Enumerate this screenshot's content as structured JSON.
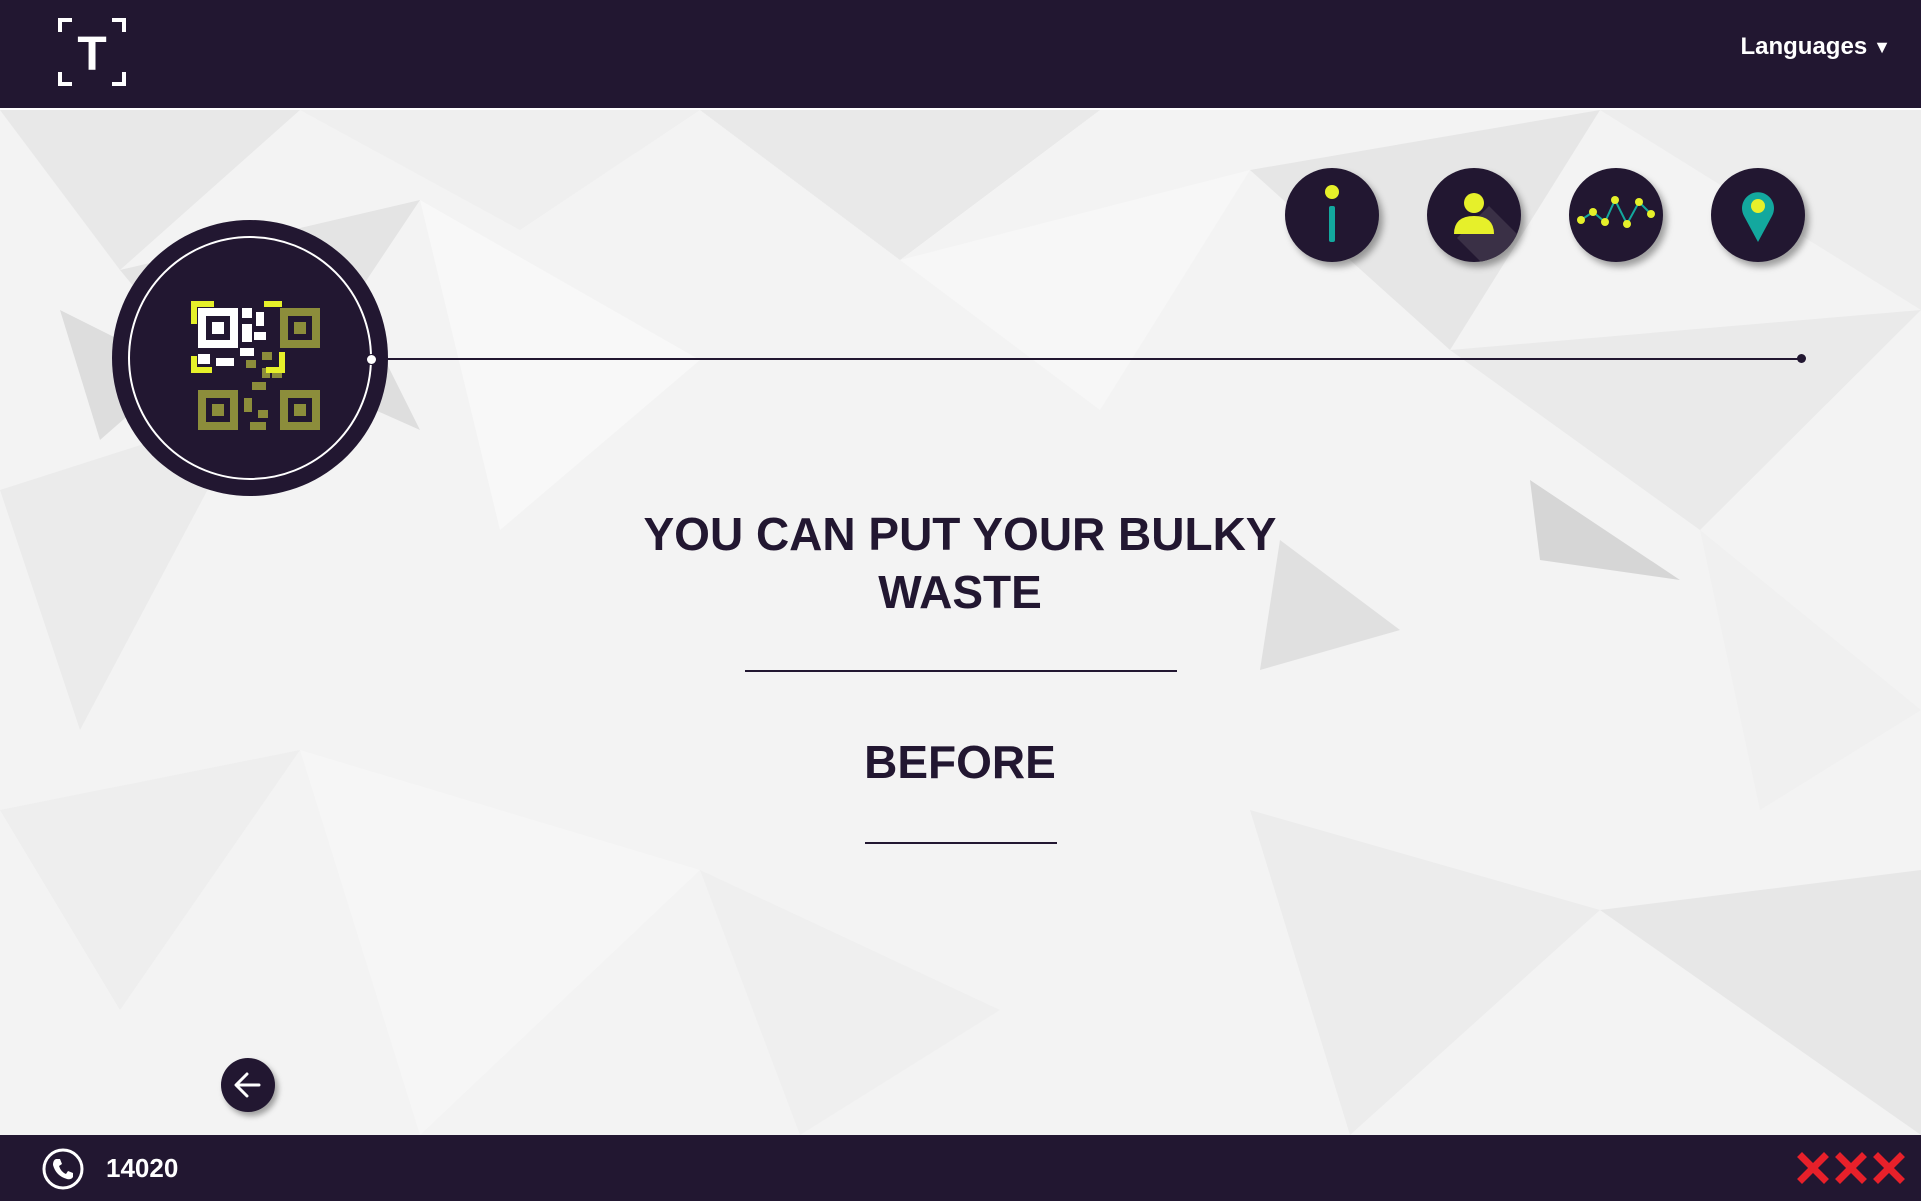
{
  "header": {
    "logo_letter": "T",
    "languages_label": "Languages",
    "languages_caret": "▼"
  },
  "icons": {
    "info": "info-icon",
    "person": "person-icon",
    "chart": "line-chart-icon",
    "location": "location-pin-icon",
    "qr": "qr-code-icon",
    "back": "arrow-left-icon",
    "phone": "phone-icon",
    "brand_marks": "xxx-icon"
  },
  "main": {
    "headline": "YOU CAN PUT YOUR BULKY WASTE",
    "subtitle": "BEFORE"
  },
  "footer": {
    "phone_number": "14020"
  },
  "colors": {
    "navy": "#221731",
    "accent_yellow": "#e6f02a",
    "accent_teal": "#13a89e",
    "qr_olive": "#8c8d3b",
    "brand_red": "#e8202a"
  }
}
